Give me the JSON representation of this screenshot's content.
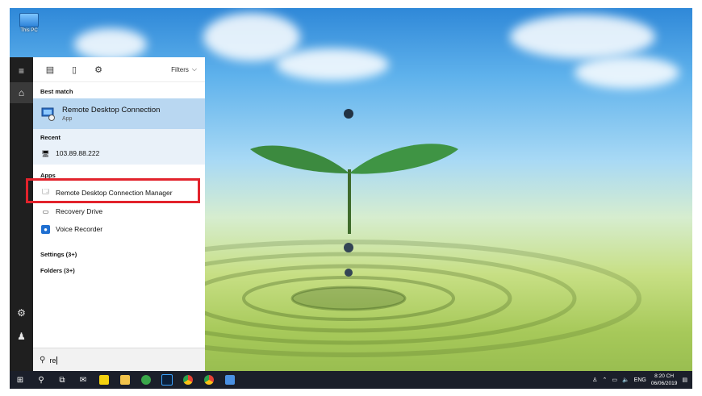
{
  "desktop": {
    "icon_label": "This PC"
  },
  "search_panel": {
    "filters_label": "Filters",
    "best_match_heading": "Best match",
    "best_match": {
      "name": "Remote Desktop Connection",
      "type": "App"
    },
    "recent_heading": "Recent",
    "recent_items": [
      "103.89.88.222"
    ],
    "apps_heading": "Apps",
    "apps": [
      "Remote Desktop Connection Manager",
      "Recovery Drive",
      "Voice Recorder"
    ],
    "settings_label": "Settings (3+)",
    "folders_label": "Folders (3+)",
    "search_query": "re"
  },
  "taskbar": {
    "tray_language": "ENG",
    "time": "8:20 CH",
    "date": "06/06/2019"
  },
  "colors": {
    "selection_bg": "#b9d7f1",
    "highlight_box": "#e2232c",
    "taskbar_bg": "#1b1f2a"
  },
  "icons": [
    "hamburger-icon",
    "home-icon",
    "settings-icon",
    "user-icon",
    "search-icon",
    "start-icon",
    "task-view-icon",
    "mail-icon",
    "sticky-notes-icon",
    "file-explorer-icon",
    "gear-app-icon",
    "photoshop-icon",
    "chrome-icon",
    "chrome-alt-icon",
    "rdc-taskbar-icon",
    "notification-icon"
  ]
}
